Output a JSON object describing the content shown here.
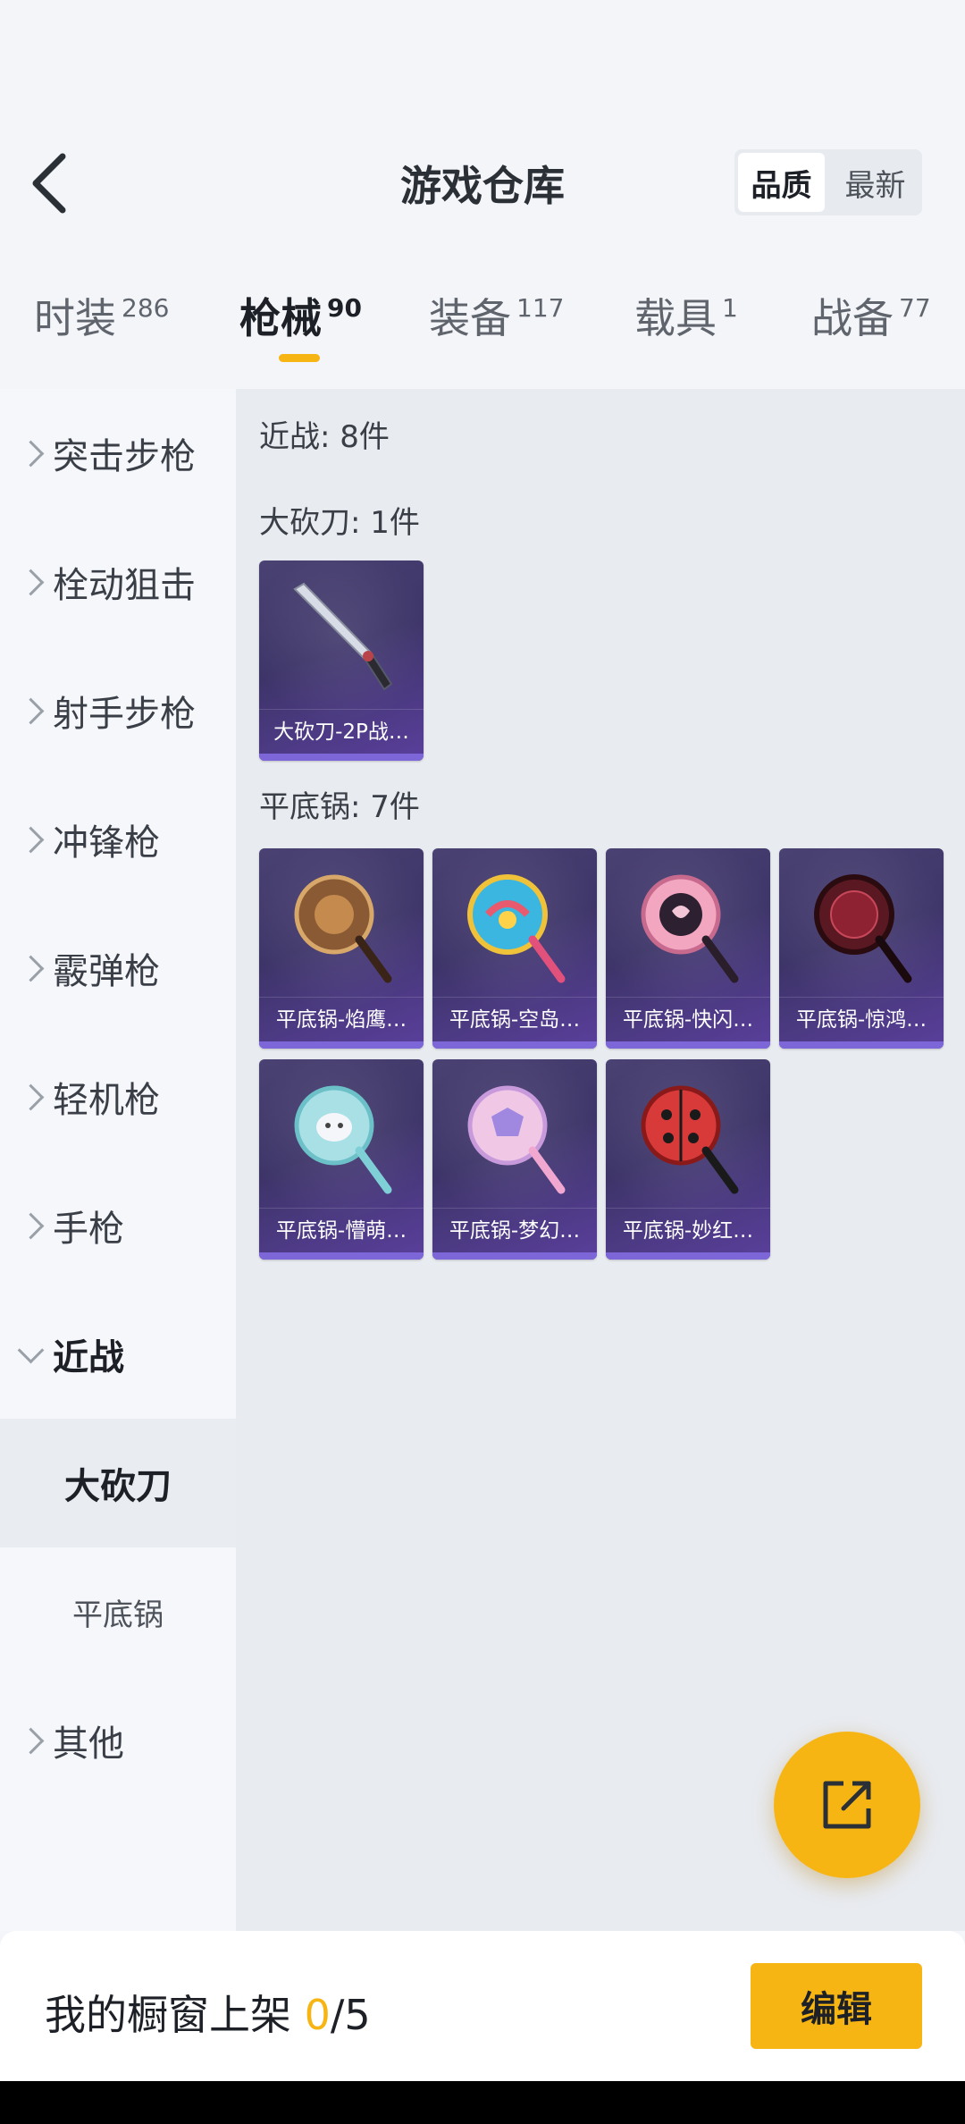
{
  "header": {
    "title": "游戏仓库",
    "sort_options": [
      {
        "label": "品质",
        "active": true
      },
      {
        "label": "最新",
        "active": false
      }
    ]
  },
  "tabs": [
    {
      "label": "时装",
      "count": "286",
      "active": false
    },
    {
      "label": "枪械",
      "count": "90",
      "active": true
    },
    {
      "label": "装备",
      "count": "117",
      "active": false
    },
    {
      "label": "载具",
      "count": "1",
      "active": false
    },
    {
      "label": "战备",
      "count": "77",
      "active": false
    }
  ],
  "sidebar": {
    "items": [
      {
        "label": "突击步枪"
      },
      {
        "label": "栓动狙击"
      },
      {
        "label": "射手步枪"
      },
      {
        "label": "冲锋枪"
      },
      {
        "label": "霰弹枪"
      },
      {
        "label": "轻机枪"
      },
      {
        "label": "手枪"
      },
      {
        "label": "近战",
        "expanded": true
      },
      {
        "label": "其他"
      }
    ],
    "subitems": [
      {
        "label": "大砍刀",
        "selected": true
      },
      {
        "label": "平底锅",
        "selected": false
      }
    ]
  },
  "content": {
    "category_total": "近战: 8件",
    "groups": [
      {
        "title": "大砍刀: 1件",
        "items": [
          {
            "name": "大砍刀-2P战…",
            "icon": "machete-icon"
          }
        ]
      },
      {
        "title": "平底锅: 7件",
        "items": [
          {
            "name": "平底锅-焰鹰…",
            "icon": "pan-bronze-icon"
          },
          {
            "name": "平底锅-空岛…",
            "icon": "pan-rainbow-icon"
          },
          {
            "name": "平底锅-快闪…",
            "icon": "pan-pink-icon"
          },
          {
            "name": "平底锅-惊鸿…",
            "icon": "pan-crimson-icon"
          },
          {
            "name": "平底锅-懵萌…",
            "icon": "pan-teal-icon"
          },
          {
            "name": "平底锅-梦幻…",
            "icon": "pan-pastel-icon"
          },
          {
            "name": "平底锅-妙红…",
            "icon": "pan-ladybug-icon"
          }
        ]
      }
    ]
  },
  "footer": {
    "label_prefix": "我的橱窗上架 ",
    "current": "0",
    "total": "/5",
    "edit_label": "编辑"
  },
  "colors": {
    "accent": "#f7b514",
    "card_bg": "#3d3468"
  }
}
